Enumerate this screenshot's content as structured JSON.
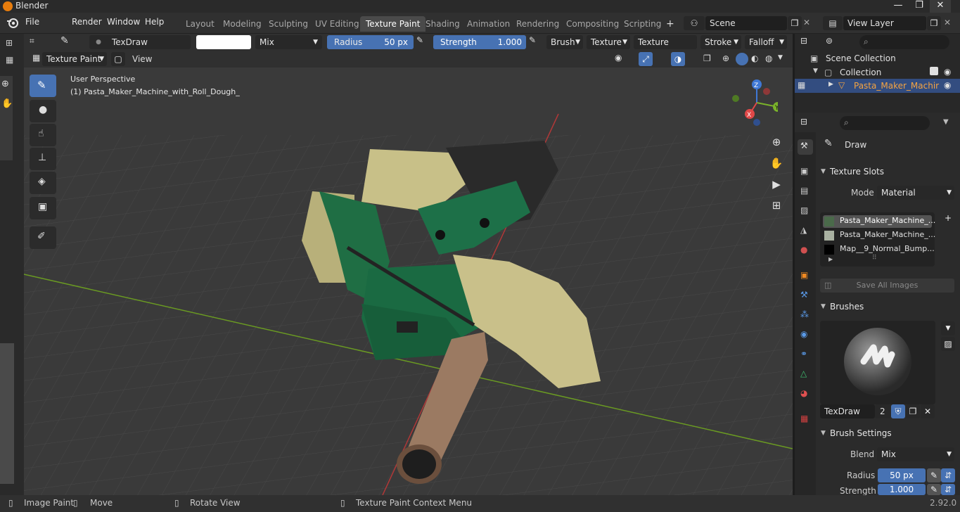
{
  "titlebar": {
    "title": "Blender",
    "minimize": "—",
    "maximize": "❐",
    "close": "✕"
  },
  "menus": [
    "File",
    "Render",
    "Window",
    "Help"
  ],
  "workspaces": [
    "Layout",
    "Modeling",
    "Sculpting",
    "UV Editing",
    "Texture Paint",
    "Shading",
    "Animation",
    "Rendering",
    "Compositing",
    "Scripting"
  ],
  "active_workspace": "Texture Paint",
  "add_workspace": "+",
  "scene": "Scene",
  "view_layer": "View Layer",
  "toolheader": {
    "brush_name": "TexDraw",
    "blend": "Mix",
    "radius_label": "Radius",
    "radius_value": "50 px",
    "strength_label": "Strength",
    "strength_value": "1.000",
    "menus": [
      "Brush",
      "Texture",
      "Texture Mask",
      "Stroke",
      "Falloff"
    ]
  },
  "mode_header": {
    "mode": "Texture Paint",
    "view": "View"
  },
  "viewport": {
    "perspective": "User Perspective",
    "object_label": "(1) Pasta_Maker_Machine_with_Roll_Dough_"
  },
  "gizmo": {
    "x": "X",
    "y": "Y",
    "z": "Z"
  },
  "outliner": {
    "scene_collection": "Scene Collection",
    "collection": "Collection",
    "object": "Pasta_Maker_Machir"
  },
  "properties": {
    "brush": "Draw",
    "texture_slots": {
      "title": "Texture Slots",
      "mode_label": "Mode",
      "mode_value": "Material",
      "slots": [
        "Pasta_Maker_Machine_...",
        "Pasta_Maker_Machine_...",
        "Map__9_Normal_Bump..."
      ],
      "save_all": "Save All Images"
    },
    "brushes": {
      "title": "Brushes",
      "name": "TexDraw",
      "users": "2"
    },
    "brush_settings": {
      "title": "Brush Settings",
      "blend_label": "Blend",
      "blend_value": "Mix",
      "radius_label": "Radius",
      "radius_value": "50 px",
      "strength_label": "Strength",
      "strength_value": "1.000"
    }
  },
  "statusbar": {
    "left": "Image Paint",
    "move": "Move",
    "rotate": "Rotate View",
    "context": "Texture Paint Context Menu",
    "version": "2.92.0"
  },
  "colors": {
    "accent": "#4772b3",
    "selected_object": "#f5a442",
    "machine_green": "#1e7a4a",
    "x_axis": "#e04848",
    "y_axis": "#7ab32a",
    "z_axis": "#3f78d6"
  }
}
